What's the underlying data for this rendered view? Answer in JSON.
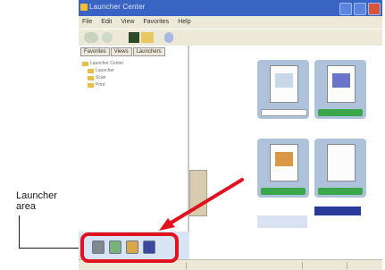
{
  "callout": {
    "line1": "Launcher",
    "line2": "area"
  },
  "window": {
    "title": "Launcher Center",
    "menu": [
      "File",
      "Edit",
      "View",
      "Favorites",
      "Help"
    ]
  },
  "left_pane": {
    "tabs": [
      "Favorites",
      "Views",
      "Launchers"
    ],
    "tree": [
      "Launcher Center",
      "Launcher",
      "Scan",
      "Print"
    ]
  },
  "launcher": {
    "icons": [
      "scanner-icon",
      "spreadsheet-icon",
      "folder-icon",
      "screen-icon"
    ]
  },
  "colors": {
    "highlight": "#e0121e",
    "title_bar": "#3a64c4",
    "caption": "#3aa84a"
  }
}
